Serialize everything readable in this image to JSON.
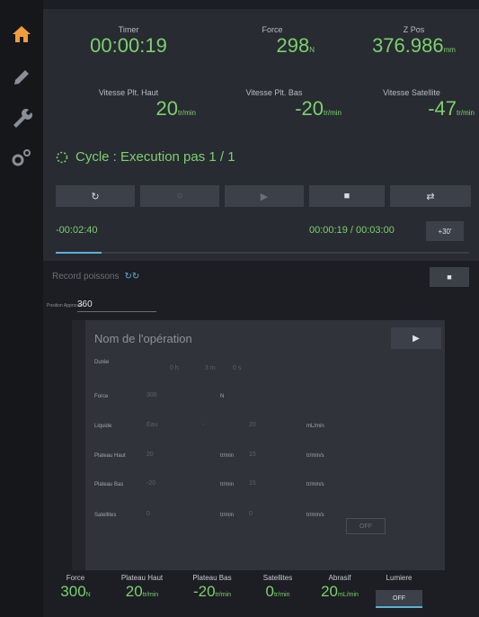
{
  "sidebar": {
    "icons": [
      "home-icon",
      "pencil-icon",
      "wrench-icon",
      "gears-icon"
    ],
    "active_color": "#f39c3c",
    "icon_color": "#8a8e96"
  },
  "stats": {
    "timer": {
      "label": "Timer",
      "value": "00:00:19"
    },
    "force": {
      "label": "Force",
      "value": "298",
      "unit": "N"
    },
    "zpos": {
      "label": "Z Pos",
      "value": "376.986",
      "unit": "mm"
    },
    "vitesse_haut": {
      "label": "Vitesse Plt. Haut",
      "value": "20",
      "unit": "tr/min"
    },
    "vitesse_bas": {
      "label": "Vitesse Plt. Bas",
      "value": "-20",
      "unit": "tr/min"
    },
    "vitesse_sat": {
      "label": "Vitesse Satellite",
      "value": "-47",
      "unit": "tr/min"
    }
  },
  "cycle": {
    "text": "Cycle : Execution pas 1 / 1"
  },
  "timing": {
    "remaining": "-00:02:40",
    "elapsed": "00:00:19 / 00:03:00",
    "plus_label": "+30'",
    "progress": 0.11
  },
  "record": {
    "label": "Record poissons"
  },
  "position": {
    "label": "Position Approche",
    "value": "360"
  },
  "form": {
    "title": "Nom de l'opération",
    "duree_label": "Durée",
    "duree_h": "0 h",
    "duree_m": "3 m",
    "duree_s": "0 s",
    "force_label": "Force",
    "force_value": "300",
    "force_unit": "N",
    "liquide_label": "Liquide",
    "liquide_value": "Eau",
    "liquide_sep": "-",
    "liquide_rate": "20",
    "liquide_unit": "mL/min",
    "haut_label": "Plateau Haut",
    "haut_value": "20",
    "haut_unit": "tr/min",
    "haut_accel": "15",
    "haut_accel_unit": "tr/min/s",
    "bas_label": "Plateau Bas",
    "bas_value": "-20",
    "bas_unit": "tr/min",
    "bas_accel": "15",
    "bas_accel_unit": "tr/min/s",
    "sat_label": "Satellites",
    "sat_value": "0",
    "sat_unit": "tr/min",
    "sat_accel": "0",
    "sat_accel_unit": "tr/min/s",
    "sat_toggle": "OFF"
  },
  "bottom": {
    "force": {
      "label": "Force",
      "value": "300",
      "unit": "N"
    },
    "haut": {
      "label": "Plateau Haut",
      "value": "20",
      "unit": "tr/min"
    },
    "bas": {
      "label": "Plateau Bas",
      "value": "-20",
      "unit": "tr/min"
    },
    "satellites": {
      "label": "Satellites",
      "value": "0",
      "unit": "tr/min"
    },
    "abrasif": {
      "label": "Abrasif",
      "value": "20",
      "unit": "mL/min"
    },
    "lumiere": {
      "label": "Lumiere",
      "value": "OFF"
    }
  }
}
